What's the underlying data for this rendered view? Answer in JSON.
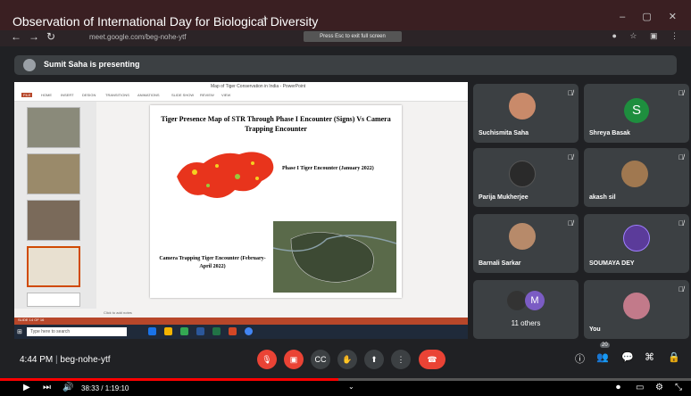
{
  "browser": {
    "video_title": "Observation of International Day for Biological Diversity",
    "url": "meet.google.com/beg-nohe-ytf",
    "fullscreen_hint": "Press Esc to exit full screen"
  },
  "presenting": {
    "text": "Sumit Saha is presenting"
  },
  "slide": {
    "title": "Tiger Presence Map of STR Through Phase I Encounter (Signs) Vs Camera Trapping Encounter",
    "phase1_label": "Phase I Tiger Encounter (January 2022)",
    "camera_label": "Camera Trapping Tiger Encounter (February- April 2022)"
  },
  "powerpoint": {
    "window_title": "Map of Tiger Conservation in India - PowerPoint",
    "tabs": [
      "FILE",
      "HOME",
      "INSERT",
      "DESIGN",
      "TRANSITIONS",
      "ANIMATIONS",
      "SLIDE SHOW",
      "REVIEW",
      "VIEW"
    ],
    "notes_placeholder": "Click to add notes",
    "status": "SLIDE 14 OF 16",
    "search_placeholder": "Type here to search"
  },
  "participants": [
    {
      "name": "Suchismita Saha",
      "initial": "",
      "color": "#c98a6a"
    },
    {
      "name": "Shreya Basak",
      "initial": "S",
      "color": "#1e8e3e"
    },
    {
      "name": "Parija Mukherjee",
      "initial": "",
      "color": "#2a2a2a"
    },
    {
      "name": "akash sil",
      "initial": "",
      "color": "#a07850"
    },
    {
      "name": "Barnali Sarkar",
      "initial": "",
      "color": "#b78a6a"
    },
    {
      "name": "SOUMAYA DEY",
      "initial": "",
      "color": "#5b3b9a"
    },
    {
      "name": "11 others",
      "initial": "M",
      "color": "#7b5cc4"
    },
    {
      "name": "You",
      "initial": "",
      "color": "#c27a8a"
    }
  ],
  "meeting": {
    "time": "4:44 PM",
    "code": "beg-nohe-ytf",
    "people_count": "20"
  },
  "youtube": {
    "time": "38:33 / 1:19:10",
    "progress": 0.49
  }
}
